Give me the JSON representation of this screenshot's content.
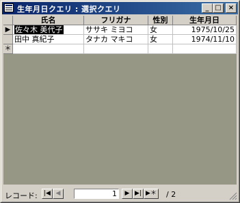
{
  "window": {
    "title": "生年月日クエリ : 選択クエリ"
  },
  "titlebar_buttons": {
    "minimize": "_",
    "maximize": "□",
    "close": "×"
  },
  "columns": [
    "氏名",
    "フリガナ",
    "性別",
    "生年月日"
  ],
  "rows": [
    {
      "name": "佐々木 美代子",
      "kana": "ササキ ミヨコ",
      "gender": "女",
      "birth": "1975/10/25",
      "current": true
    },
    {
      "name": "田中 真紀子",
      "kana": "タナカ マキコ",
      "gender": "女",
      "birth": "1974/11/10",
      "current": false
    }
  ],
  "new_row_marker": "＊",
  "current_row_marker": "▶",
  "nav": {
    "label": "レコード:",
    "current": "1",
    "total": "/ 2",
    "first": "|◀",
    "prev": "◀",
    "next": "▶",
    "last": "▶|",
    "new": "▶＊"
  },
  "colors": {
    "title_start": "#0a246a",
    "title_end": "#3a6ea5",
    "grid_bg": "#979786",
    "selection": "#000000"
  }
}
